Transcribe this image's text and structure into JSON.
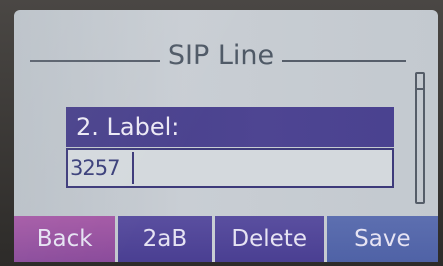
{
  "screen": {
    "title": "SIP Line"
  },
  "form": {
    "field_label": "2. Label:",
    "field_value": "3257"
  },
  "softkeys": {
    "back": "Back",
    "mode": "2aB",
    "delete": "Delete",
    "save": "Save"
  },
  "colors": {
    "screen_bg": "#c3c9cf",
    "highlight_bar": "#4a4290",
    "back_key": "#9a52a2",
    "save_key": "#566aab",
    "title_text": "#4f5966"
  }
}
